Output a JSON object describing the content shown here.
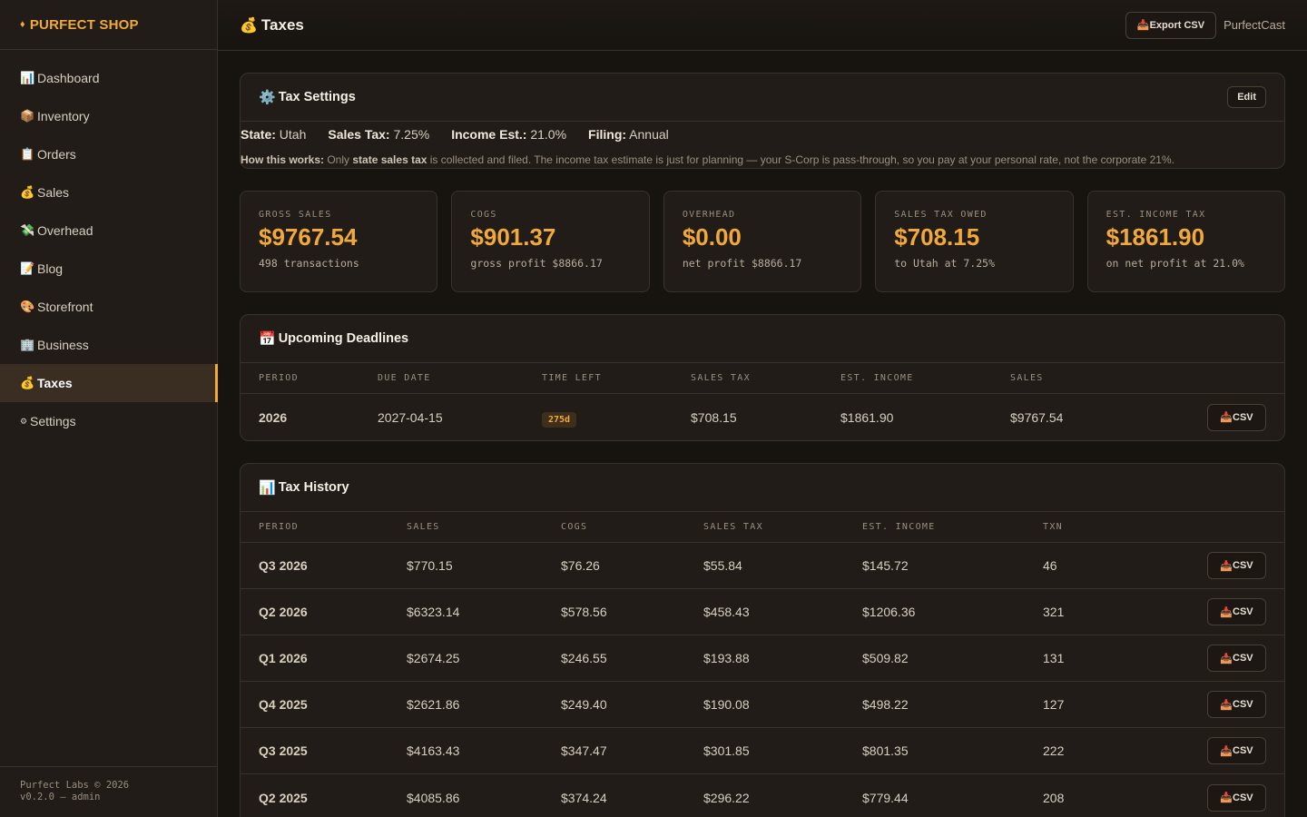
{
  "brand": {
    "diamond": "♦",
    "name": "PURFECT SHOP"
  },
  "sidebar": {
    "items": [
      {
        "icon": "📊",
        "label": "Dashboard"
      },
      {
        "icon": "📦",
        "label": "Inventory"
      },
      {
        "icon": "📋",
        "label": "Orders"
      },
      {
        "icon": "💰",
        "label": "Sales"
      },
      {
        "icon": "💸",
        "label": "Overhead"
      },
      {
        "icon": "📝",
        "label": "Blog"
      },
      {
        "icon": "🎨",
        "label": "Storefront"
      },
      {
        "icon": "🏢",
        "label": "Business"
      },
      {
        "icon": "💰",
        "label": "Taxes"
      },
      {
        "icon": "⚙",
        "label": "Settings"
      }
    ],
    "active": "Taxes",
    "footer": {
      "line1": "Purfect Labs © 2026",
      "line2": "v0.2.0 — admin"
    }
  },
  "header": {
    "icon": "💰",
    "title": "Taxes",
    "export_icon": "📥",
    "export_label": "Export CSV",
    "user": "PurfectCast"
  },
  "settings": {
    "icon": "⚙️",
    "title": "Tax Settings",
    "edit_label": "Edit",
    "state_label": "State:",
    "state": "Utah",
    "sales_tax_label": "Sales Tax:",
    "sales_tax": "7.25%",
    "income_label": "Income Est.:",
    "income": "21.0%",
    "filing_label": "Filing:",
    "filing": "Annual",
    "note_lead": "How this works:",
    "note_a": " Only ",
    "note_b": "state sales tax",
    "note_c": " is collected and filed. The income tax estimate is just for planning — your S-Corp is pass-through, so you pay at your personal rate, not the corporate 21%."
  },
  "stats": [
    {
      "label": "GROSS SALES",
      "value": "$9767.54",
      "sub": "498 transactions"
    },
    {
      "label": "COGS",
      "value": "$901.37",
      "sub": "gross profit $8866.17"
    },
    {
      "label": "OVERHEAD",
      "value": "$0.00",
      "sub": "net profit $8866.17"
    },
    {
      "label": "SALES TAX OWED",
      "value": "$708.15",
      "sub": "to Utah at 7.25%"
    },
    {
      "label": "EST. INCOME TAX",
      "value": "$1861.90",
      "sub": "on net profit at 21.0%"
    }
  ],
  "deadlines": {
    "icon": "📅",
    "title": "Upcoming Deadlines",
    "columns": [
      "PERIOD",
      "DUE DATE",
      "TIME LEFT",
      "SALES TAX",
      "EST. INCOME",
      "SALES"
    ],
    "rows": [
      {
        "period": "2026",
        "due": "2027-04-15",
        "left": "275d",
        "sales_tax": "$708.15",
        "income": "$1861.90",
        "sales": "$9767.54"
      }
    ]
  },
  "csv": {
    "icon": "📥",
    "label": "CSV"
  },
  "history": {
    "icon": "📊",
    "title": "Tax History",
    "columns": [
      "PERIOD",
      "SALES",
      "COGS",
      "SALES TAX",
      "EST. INCOME",
      "TXN"
    ],
    "rows": [
      {
        "period": "Q3 2026",
        "sales": "$770.15",
        "cogs": "$76.26",
        "sales_tax": "$55.84",
        "income": "$145.72",
        "txn": "46"
      },
      {
        "period": "Q2 2026",
        "sales": "$6323.14",
        "cogs": "$578.56",
        "sales_tax": "$458.43",
        "income": "$1206.36",
        "txn": "321"
      },
      {
        "period": "Q1 2026",
        "sales": "$2674.25",
        "cogs": "$246.55",
        "sales_tax": "$193.88",
        "income": "$509.82",
        "txn": "131"
      },
      {
        "period": "Q4 2025",
        "sales": "$2621.86",
        "cogs": "$249.40",
        "sales_tax": "$190.08",
        "income": "$498.22",
        "txn": "127"
      },
      {
        "period": "Q3 2025",
        "sales": "$4163.43",
        "cogs": "$347.47",
        "sales_tax": "$301.85",
        "income": "$801.35",
        "txn": "222"
      },
      {
        "period": "Q2 2025",
        "sales": "$4085.86",
        "cogs": "$374.24",
        "sales_tax": "$296.22",
        "income": "$779.44",
        "txn": "208"
      }
    ]
  }
}
